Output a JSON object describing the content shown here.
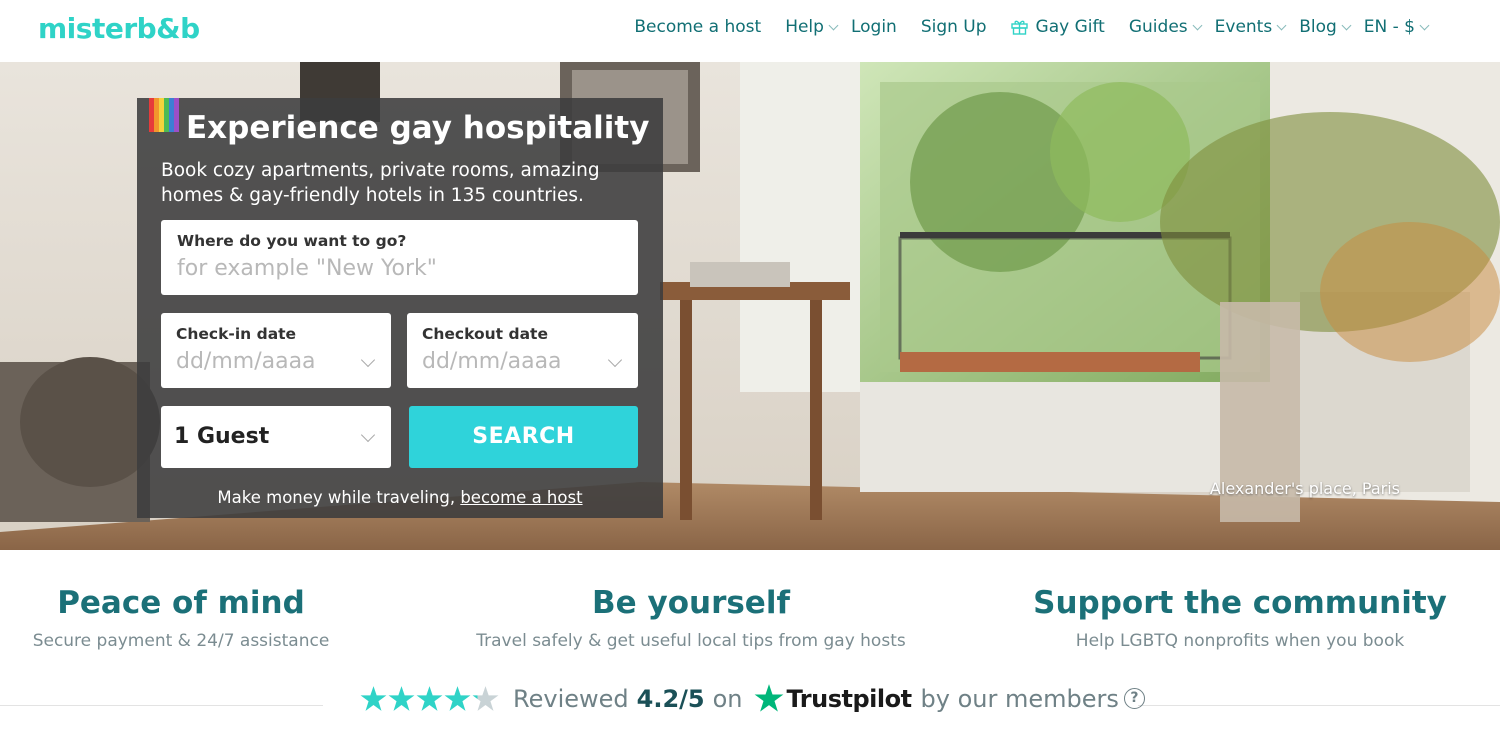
{
  "brand": {
    "logo_text": "misterb&b",
    "accent": "#2fd3c7"
  },
  "nav": {
    "become_host": "Become a host",
    "help": "Help",
    "login": "Login",
    "signup": "Sign Up",
    "gift": "Gay Gift",
    "guides": "Guides",
    "events": "Events",
    "blog": "Blog",
    "locale": "EN - $"
  },
  "hero": {
    "title": "Experience gay hospitality",
    "subtitle": "Book cozy apartments, private rooms, amazing homes & gay-friendly hotels in 135 countries.",
    "caption": "Alexander's place, Paris"
  },
  "search": {
    "destination_label": "Where do you want to go?",
    "destination_placeholder": "for example \"New York\"",
    "checkin_label": "Check-in date",
    "checkin_placeholder": "dd/mm/aaaa",
    "checkout_label": "Checkout date",
    "checkout_placeholder": "dd/mm/aaaa",
    "guests_value": "1 Guest",
    "search_button": "SEARCH",
    "host_text": "Make money while traveling,",
    "host_link": "become a host"
  },
  "features": [
    {
      "title": "Peace of mind",
      "subtitle": "Secure payment & 24/7 assistance"
    },
    {
      "title": "Be yourself",
      "subtitle": "Travel safely & get useful local tips from gay hosts"
    },
    {
      "title": "Support the community",
      "subtitle": "Help LGBTQ nonprofits when you book"
    }
  ],
  "review": {
    "prefix": "Reviewed",
    "score": "4.2/5",
    "on": "on",
    "provider": "Trustpilot",
    "suffix": "by our members",
    "help_icon": "?",
    "rating": 4.2,
    "max": 5,
    "star_color": "#2fd3c7",
    "icons": [
      "star-icon",
      "trustpilot-star-icon",
      "question-icon",
      "gift-icon",
      "chevron-down-icon"
    ]
  }
}
